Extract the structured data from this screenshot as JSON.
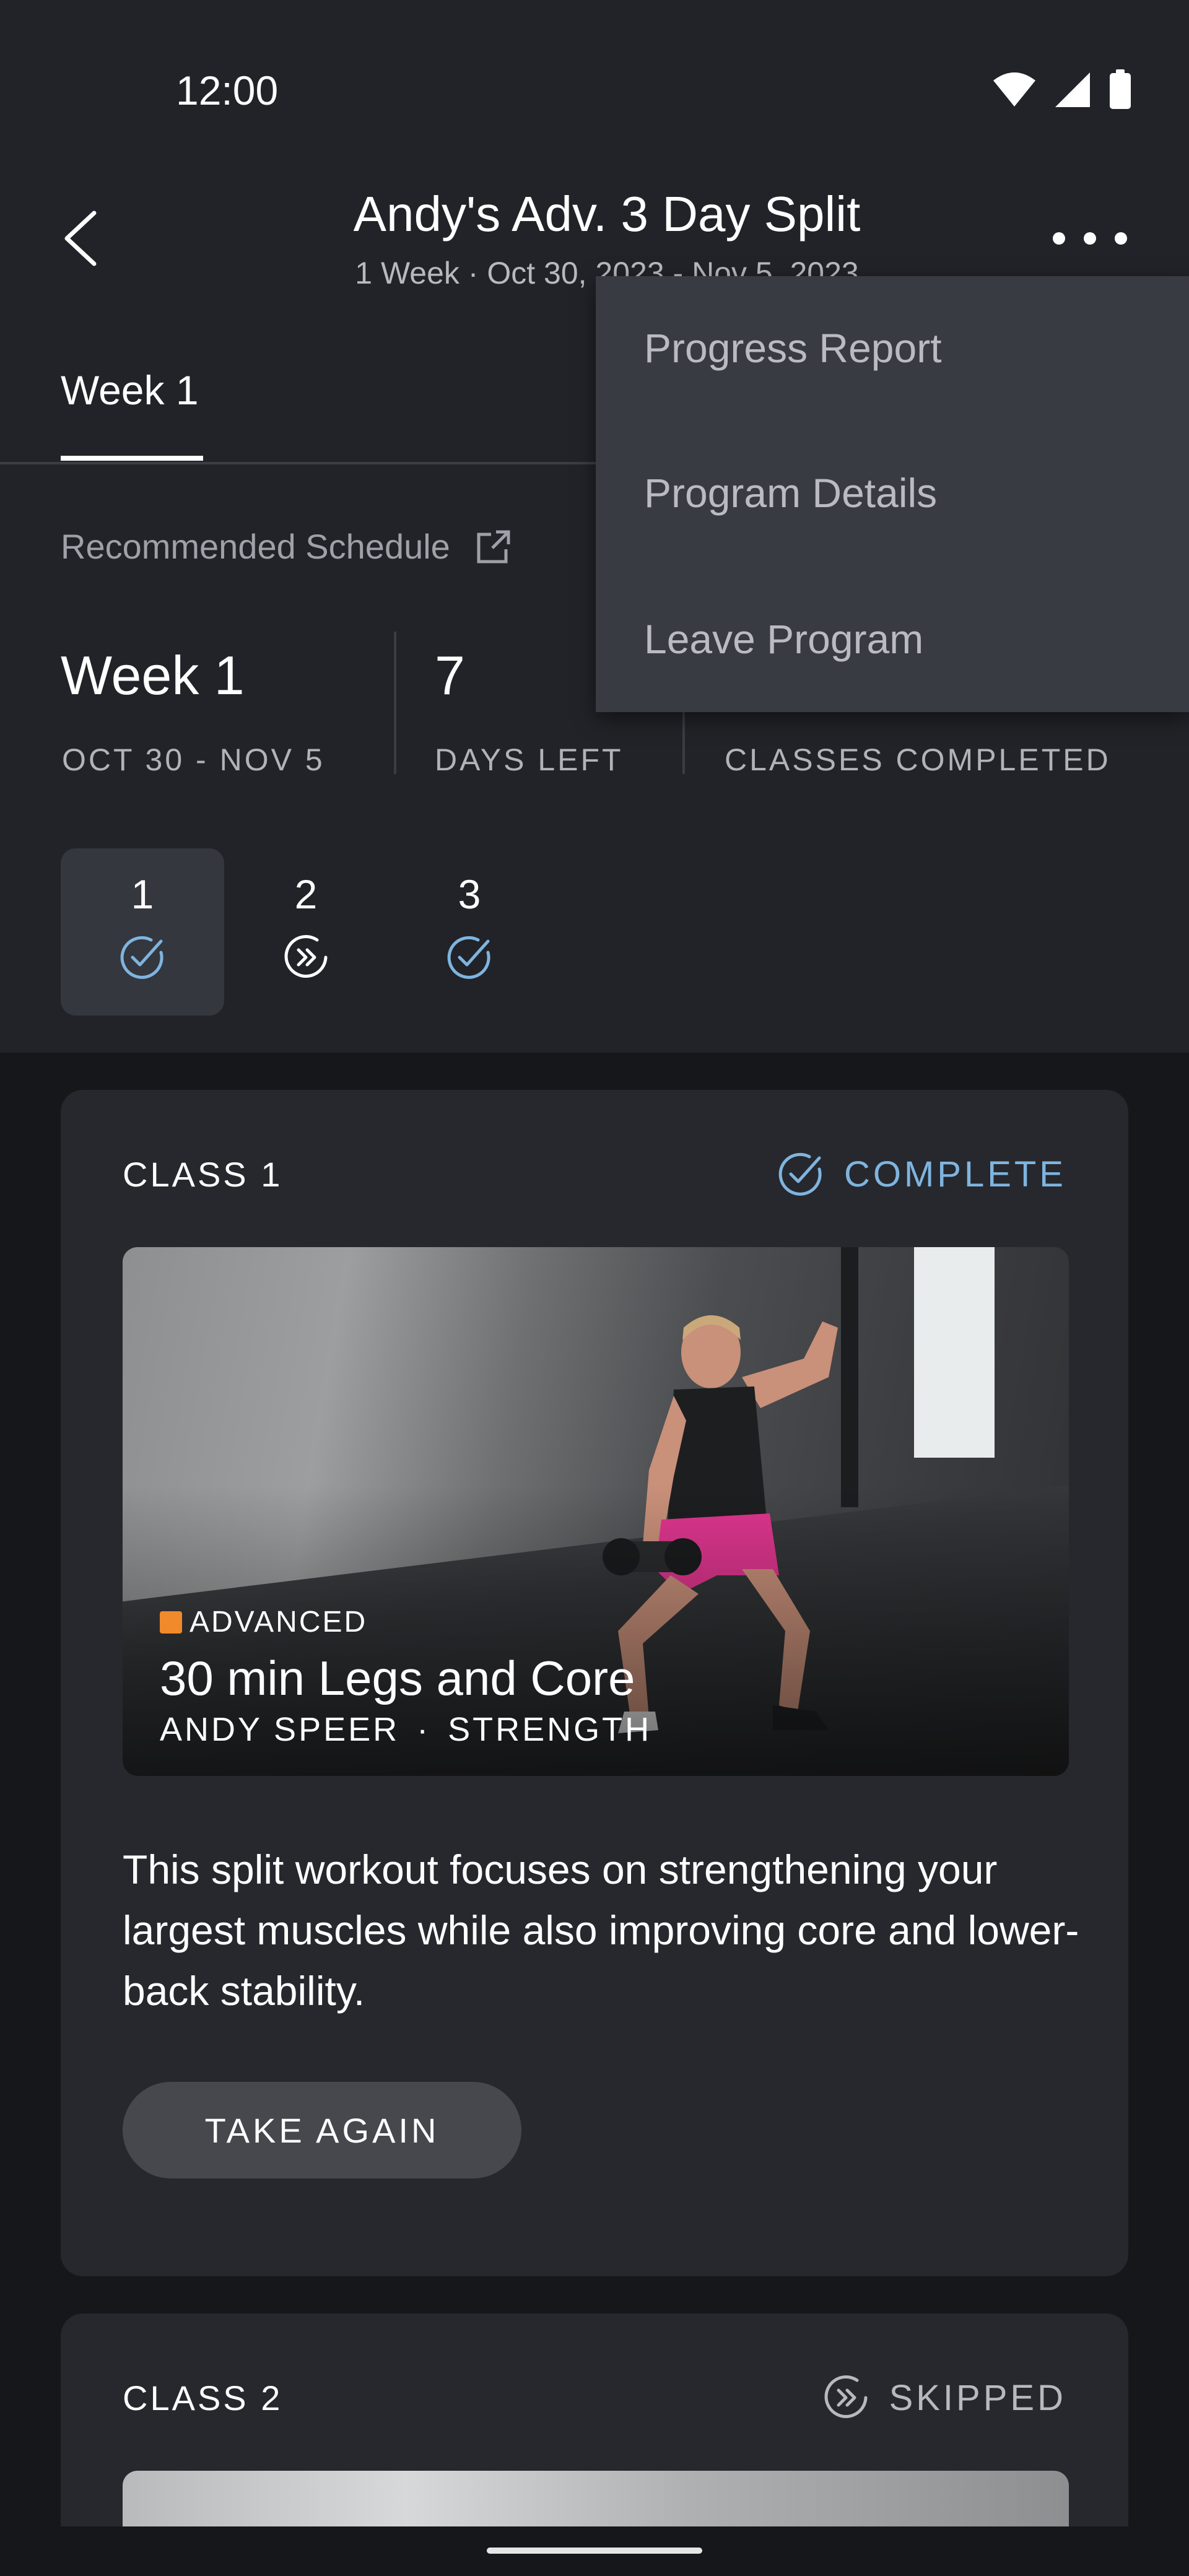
{
  "status_bar": {
    "time": "12:00"
  },
  "header": {
    "title": "Andy's Adv. 3 Day Split",
    "subtitle": "1 Week · Oct 30, 2023 - Nov 5, 2023"
  },
  "tabs": [
    {
      "label": "Week 1",
      "selected": true
    }
  ],
  "recommended_schedule": {
    "label": "Recommended Schedule"
  },
  "stats": {
    "week": {
      "value": "Week 1",
      "label": "OCT 30 - NOV 5"
    },
    "days_left": {
      "value": "7",
      "label": "DAYS LEFT"
    },
    "classes_completed": {
      "value": "",
      "label": "CLASSES COMPLETED"
    }
  },
  "days": [
    {
      "number": "1",
      "status": "complete",
      "selected": true
    },
    {
      "number": "2",
      "status": "skipped",
      "selected": false
    },
    {
      "number": "3",
      "status": "complete",
      "selected": false
    }
  ],
  "menu": {
    "items": [
      "Progress Report",
      "Program Details",
      "Leave Program"
    ]
  },
  "classes": [
    {
      "label": "CLASS 1",
      "status": "COMPLETE",
      "level": "ADVANCED",
      "title": "30 min Legs and Core",
      "instructor": "ANDY SPEER",
      "separator": "·",
      "category": "STRENGTH",
      "description": "This split workout focuses on strengthening your largest muscles while also improving core and lower-back stability.",
      "button": "TAKE AGAIN"
    },
    {
      "label": "CLASS 2",
      "status": "SKIPPED"
    }
  ],
  "colors": {
    "accent_complete": "#7fb4df",
    "level_advanced": "#f08a2a",
    "background": "#15171a",
    "surface": "#26282d"
  }
}
